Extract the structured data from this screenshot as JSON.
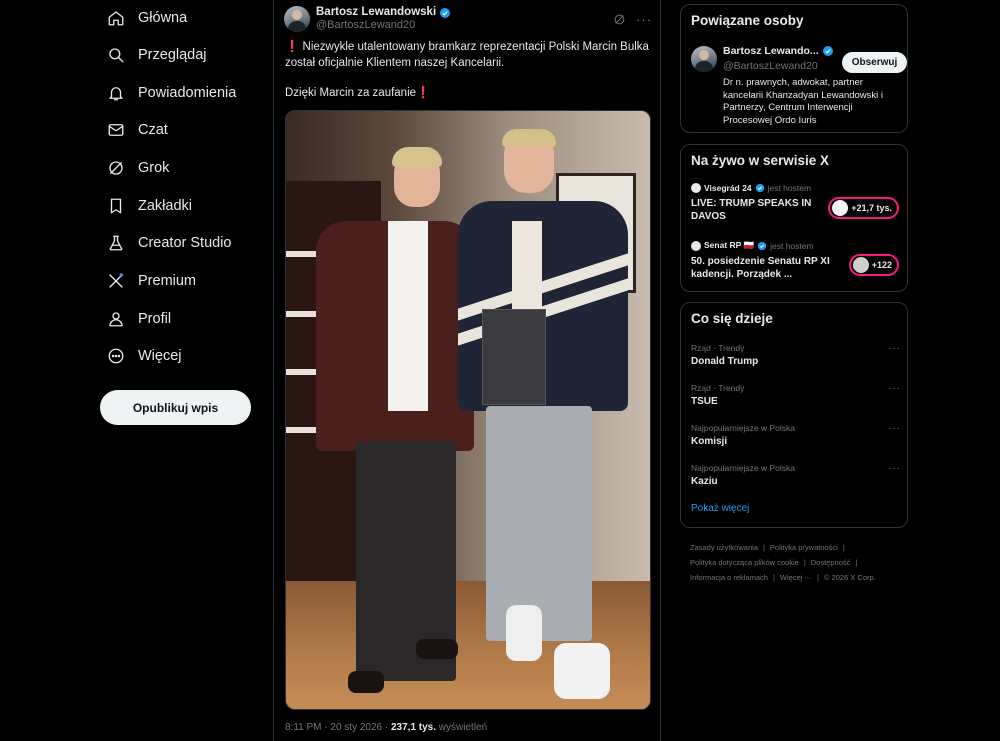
{
  "nav": {
    "items": [
      {
        "label": "Główna",
        "icon": "home-icon"
      },
      {
        "label": "Przeglądaj",
        "icon": "search-icon"
      },
      {
        "label": "Powiadomienia",
        "icon": "bell-icon"
      },
      {
        "label": "Czat",
        "icon": "mail-icon"
      },
      {
        "label": "Grok",
        "icon": "grok-icon"
      },
      {
        "label": "Zakładki",
        "icon": "bookmark-icon"
      },
      {
        "label": "Creator Studio",
        "icon": "flask-icon"
      },
      {
        "label": "Premium",
        "icon": "x-logo-icon"
      },
      {
        "label": "Profil",
        "icon": "person-icon"
      },
      {
        "label": "Więcej",
        "icon": "more-circle-icon"
      }
    ],
    "post_button": "Opublikuj wpis"
  },
  "post": {
    "author_name": "Bartosz Lewandowski",
    "author_handle": "@BartoszLewand20",
    "text_line1": "Niezwykle utalentowany bramkarz reprezentacji Polski Marcin Bulka został oficjalnie Klientem naszej Kancelarii.",
    "text_line2": "Dzięki Marcin za zaufanie",
    "excl": "❗",
    "time": "8:11 PM · 20 sty 2026 · ",
    "views_count": "237,1 tys.",
    "views_label": " wyświetleń"
  },
  "related": {
    "title": "Powiązane osoby",
    "name": "Bartosz Lewando...",
    "handle": "@BartoszLewand20",
    "follow": "Obserwuj",
    "bio": "Dr n. prawnych, adwokat, partner kancelarii Khanzadyan Lewandowski i Partnerzy, Centrum Interwencji Procesowej Ordo Iuris"
  },
  "live": {
    "title": "Na żywo w serwisie X",
    "items": [
      {
        "host": "Visegrád 24",
        "host_suffix": "jest hostem",
        "title": "LIVE: TRUMP SPEAKS IN DAVOS",
        "count": "+21,7 tys."
      },
      {
        "host": "Senat RP 🇵🇱",
        "host_suffix": "jest hostem",
        "title": "50. posiedzenie Senatu RP XI kadencji. Porządek ...",
        "count": "+122"
      }
    ]
  },
  "trends": {
    "title": "Co się dzieje",
    "items": [
      {
        "category": "Rząd · Trendy",
        "name": "Donald Trump"
      },
      {
        "category": "Rząd · Trendy",
        "name": "TSUE"
      },
      {
        "category": "Najpopularniejsze w Polska",
        "name": "Komisji"
      },
      {
        "category": "Najpopularniejsze w Polska",
        "name": "Kaziu"
      }
    ],
    "show_more": "Pokaż więcej"
  },
  "footer": {
    "terms": "Zasady użytkowania",
    "privacy": "Polityka prywatności",
    "cookies": "Polityka dotycząca plików cookie",
    "accessibility": "Dostępność",
    "ads": "Informacja o reklamach",
    "more": "Więcej ···",
    "copyright": "© 2026 X Corp."
  },
  "colors": {
    "background": "#000000",
    "accent": "#1d9bf0",
    "live": "#f91880",
    "border": "#2f3336"
  }
}
